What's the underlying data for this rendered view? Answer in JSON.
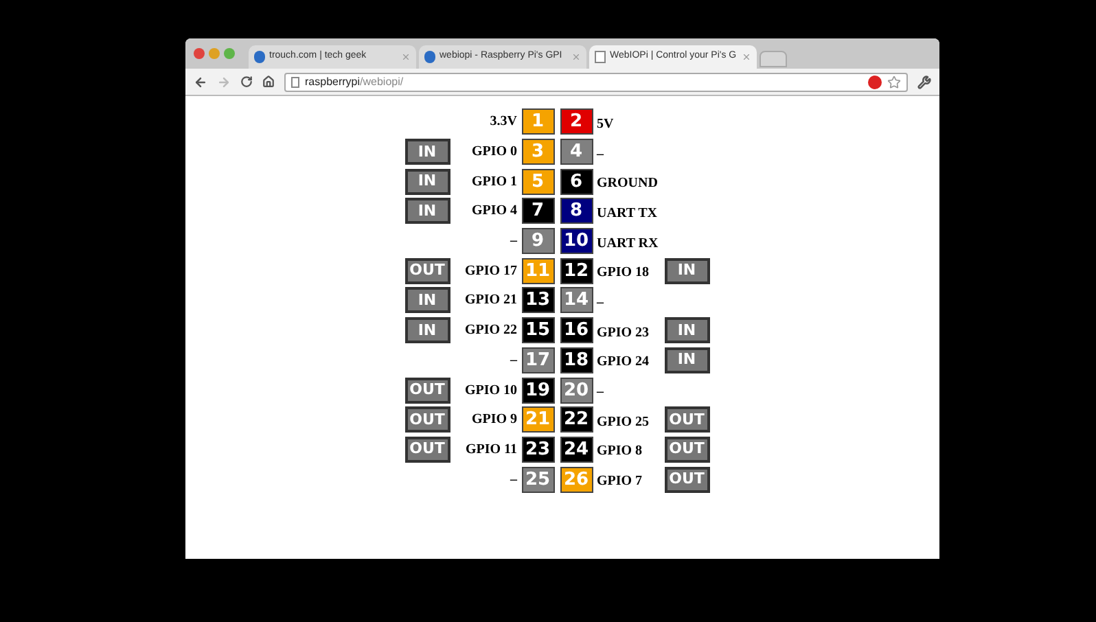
{
  "browser": {
    "tabs": [
      {
        "title": "trouch.com | tech geek",
        "selected": false
      },
      {
        "title": "webiopi - Raspberry Pi's GPI",
        "selected": false
      },
      {
        "title": "WebIOPi | Control your Pi's G",
        "selected": true
      }
    ],
    "address": {
      "host": "raspberrypi",
      "path": "/webiopi/"
    }
  },
  "header": {
    "left_label": "3.3V",
    "left_pin": {
      "number": "1",
      "color": "#f5a300"
    },
    "right_pin": {
      "number": "2",
      "color": "#e00000"
    },
    "right_label": "5V"
  },
  "rows": [
    {
      "left_button": "IN",
      "left_label": "GPIO 0",
      "left_pin": {
        "number": "3",
        "color": "#f5a300"
      },
      "right_pin": {
        "number": "4",
        "color": "#808080"
      },
      "right_label": "–"
    },
    {
      "left_button": "IN",
      "left_label": "GPIO 1",
      "left_pin": {
        "number": "5",
        "color": "#f5a300"
      },
      "right_pin": {
        "number": "6",
        "color": "#000000"
      },
      "right_label": "GROUND"
    },
    {
      "left_button": "IN",
      "left_label": "GPIO 4",
      "left_pin": {
        "number": "7",
        "color": "#000000"
      },
      "right_pin": {
        "number": "8",
        "color": "#000080"
      },
      "right_label": "UART TX"
    },
    {
      "left_label": "–",
      "left_pin": {
        "number": "9",
        "color": "#808080"
      },
      "right_pin": {
        "number": "10",
        "color": "#000080"
      },
      "right_label": "UART RX"
    },
    {
      "left_button": "OUT",
      "left_label": "GPIO 17",
      "left_pin": {
        "number": "11",
        "color": "#f5a300"
      },
      "right_pin": {
        "number": "12",
        "color": "#000000"
      },
      "right_label": "GPIO 18",
      "right_button": "IN"
    },
    {
      "left_button": "IN",
      "left_label": "GPIO 21",
      "left_pin": {
        "number": "13",
        "color": "#000000"
      },
      "right_pin": {
        "number": "14",
        "color": "#808080"
      },
      "right_label": "–"
    },
    {
      "left_button": "IN",
      "left_label": "GPIO 22",
      "left_pin": {
        "number": "15",
        "color": "#000000"
      },
      "right_pin": {
        "number": "16",
        "color": "#000000"
      },
      "right_label": "GPIO 23",
      "right_button": "IN"
    },
    {
      "left_label": "–",
      "left_pin": {
        "number": "17",
        "color": "#808080"
      },
      "right_pin": {
        "number": "18",
        "color": "#000000"
      },
      "right_label": "GPIO 24",
      "right_button": "IN"
    },
    {
      "left_button": "OUT",
      "left_label": "GPIO 10",
      "left_pin": {
        "number": "19",
        "color": "#000000"
      },
      "right_pin": {
        "number": "20",
        "color": "#808080"
      },
      "right_label": "–"
    },
    {
      "left_button": "OUT",
      "left_label": "GPIO 9",
      "left_pin": {
        "number": "21",
        "color": "#f5a300"
      },
      "right_pin": {
        "number": "22",
        "color": "#000000"
      },
      "right_label": "GPIO 25",
      "right_button": "OUT"
    },
    {
      "left_button": "OUT",
      "left_label": "GPIO 11",
      "left_pin": {
        "number": "23",
        "color": "#000000"
      },
      "right_pin": {
        "number": "24",
        "color": "#000000"
      },
      "right_label": "GPIO 8",
      "right_button": "OUT"
    },
    {
      "left_label": "–",
      "left_pin": {
        "number": "25",
        "color": "#808080"
      },
      "right_pin": {
        "number": "26",
        "color": "#f5a300"
      },
      "right_label": "GPIO 7",
      "right_button": "OUT"
    }
  ]
}
